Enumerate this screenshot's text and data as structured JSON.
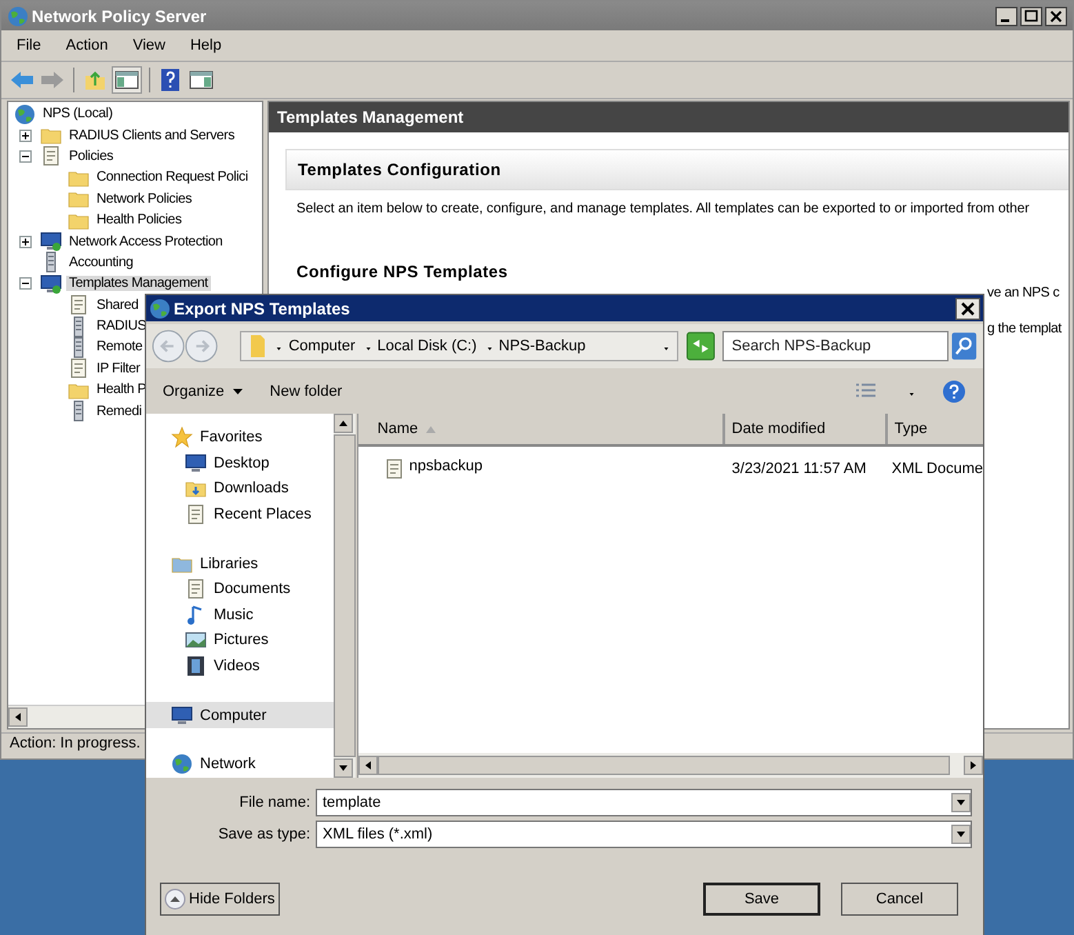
{
  "window": {
    "title": "Network Policy Server"
  },
  "menu": [
    "File",
    "Action",
    "View",
    "Help"
  ],
  "tree": [
    {
      "label": "NPS (Local)",
      "kind": "globe",
      "selected": false,
      "children": [
        {
          "label": "RADIUS Clients and Servers",
          "kind": "folder",
          "expanded": false,
          "selected": false
        },
        {
          "label": "Policies",
          "kind": "scroll",
          "expanded": true,
          "selected": false,
          "children": [
            {
              "label": "Connection Request Polici",
              "kind": "folder",
              "selected": false
            },
            {
              "label": "Network Policies",
              "kind": "folder",
              "selected": false
            },
            {
              "label": "Health Policies",
              "kind": "folder",
              "selected": false
            }
          ]
        },
        {
          "label": "Network Access Protection",
          "kind": "nap",
          "expanded": false,
          "selected": false
        },
        {
          "label": "Accounting",
          "kind": "server",
          "selected": false
        },
        {
          "label": "Templates Management",
          "kind": "nap",
          "expanded": true,
          "selected": true,
          "children": [
            {
              "label": "Shared",
              "kind": "scroll",
              "selected": false
            },
            {
              "label": "RADIUS",
              "kind": "server",
              "selected": false
            },
            {
              "label": "Remote",
              "kind": "server",
              "selected": false
            },
            {
              "label": "IP Filter",
              "kind": "scroll",
              "selected": false
            },
            {
              "label": "Health P",
              "kind": "folder",
              "selected": false
            },
            {
              "label": "Remedi",
              "kind": "server",
              "selected": false
            }
          ]
        }
      ]
    }
  ],
  "pane": {
    "header": "Templates Management",
    "section_title": "Templates Configuration",
    "description": "Select an item below to create, configure, and manage templates. All templates can be exported to or imported from other",
    "subheading": "Configure NPS Templates",
    "fragments": [
      "ve an NPS c",
      "g the templat"
    ]
  },
  "status_bar": "Action:  In progress.",
  "dialog": {
    "title": "Export NPS Templates",
    "breadcrumb": [
      "Computer",
      "Local Disk (C:)",
      "NPS-Backup"
    ],
    "search": {
      "placeholder": "Search NPS-Backup"
    },
    "toolbar": [
      "Organize",
      "New folder"
    ],
    "nav": [
      {
        "label": "Favorites",
        "kind": "star",
        "selected": false,
        "children": [
          {
            "label": "Desktop",
            "kind": "desktop",
            "selected": false
          },
          {
            "label": "Downloads",
            "kind": "downloads",
            "selected": false
          },
          {
            "label": "Recent Places",
            "kind": "recent",
            "selected": false
          }
        ]
      },
      {
        "label": "Libraries",
        "kind": "library",
        "selected": false,
        "children": [
          {
            "label": "Documents",
            "kind": "document",
            "selected": false
          },
          {
            "label": "Music",
            "kind": "music",
            "selected": false
          },
          {
            "label": "Pictures",
            "kind": "pictures",
            "selected": false
          },
          {
            "label": "Videos",
            "kind": "videos",
            "selected": false
          }
        ]
      },
      {
        "label": "Computer",
        "kind": "computer",
        "selected": true
      },
      {
        "label": "Network",
        "kind": "network",
        "selected": false
      }
    ],
    "columns": [
      {
        "label": "Name",
        "sorted": true
      },
      {
        "label": "Date modified",
        "sorted": false
      },
      {
        "label": "Type",
        "sorted": false
      }
    ],
    "files": [
      {
        "name": "npsbackup",
        "date_modified": "3/23/2021 11:57 AM",
        "type": "XML Docume"
      }
    ],
    "file_name_label": "File name:",
    "file_name": "template",
    "save_as_type_label": "Save as type:",
    "save_as_type": "XML files (*.xml)",
    "hide_folders": "Hide Folders",
    "buttons": [
      "Save",
      "Cancel"
    ]
  }
}
